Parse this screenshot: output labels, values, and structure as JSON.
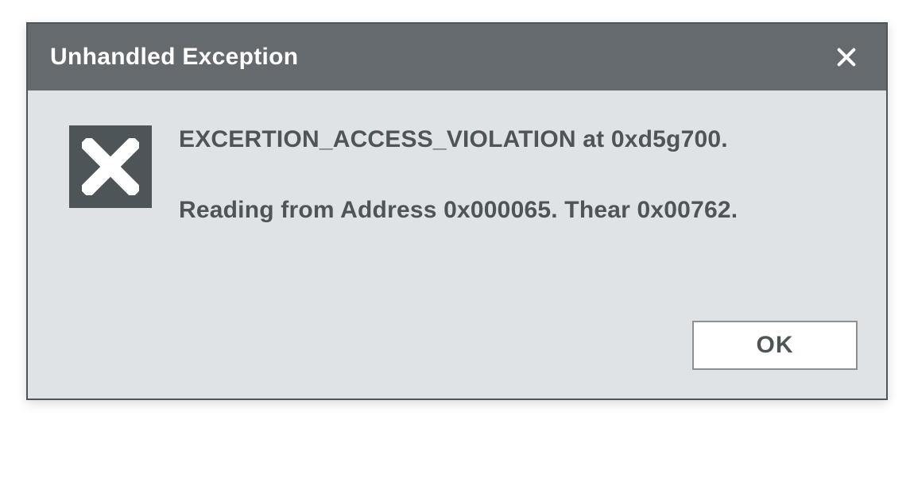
{
  "dialog": {
    "title": "Unhandled Exception",
    "messages": [
      "EXCERTION_ACCESS_VIOLATION at 0xd5g700.",
      "Reading from Address 0x000065. Thear 0x00762."
    ],
    "ok_label": "OK"
  }
}
